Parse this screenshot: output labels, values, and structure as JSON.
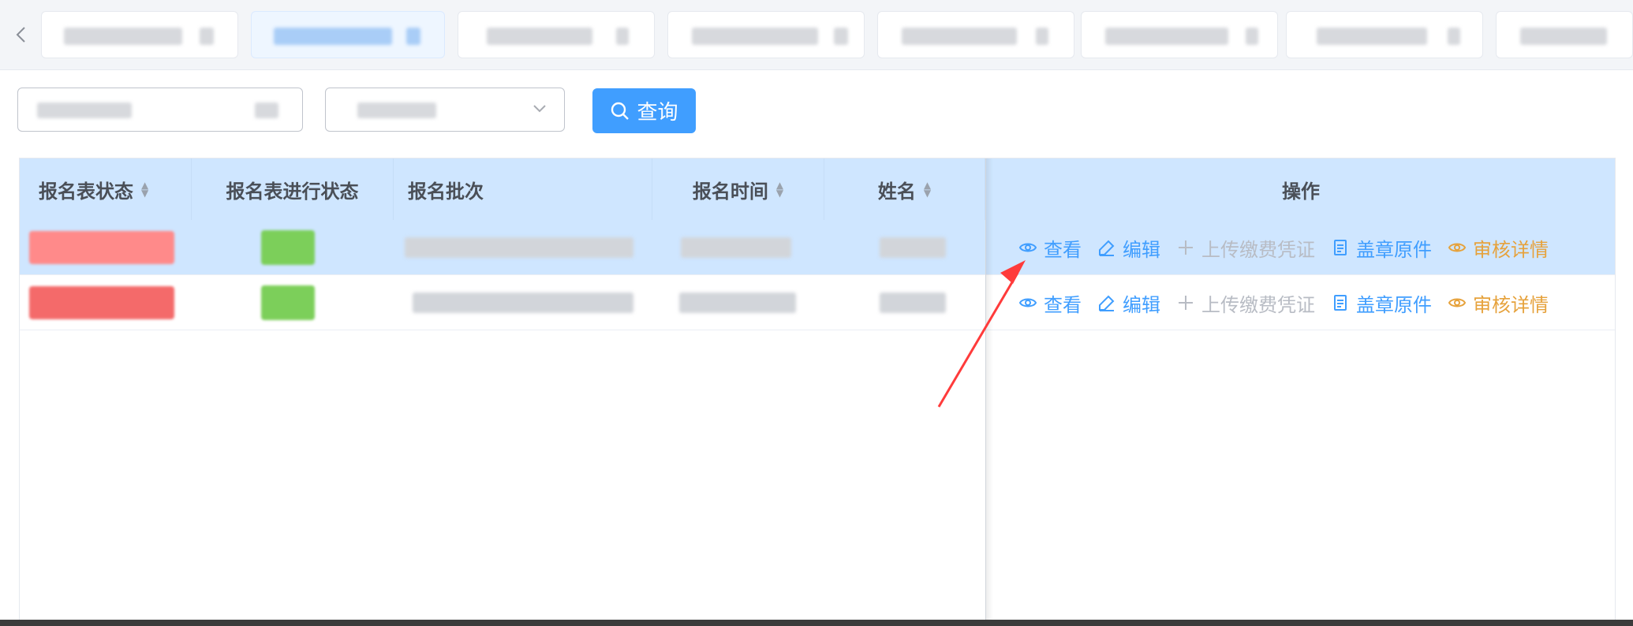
{
  "query_button": {
    "label": "查询"
  },
  "table": {
    "headers": {
      "status": "报名表状态",
      "progress": "报名表进行状态",
      "batch": "报名批次",
      "time": "报名时间",
      "name": "姓名",
      "actions": "操作"
    },
    "action_labels": {
      "view": "查看",
      "edit": "编辑",
      "upload": "上传缴费凭证",
      "stamp": "盖章原件",
      "audit": "审核详情"
    }
  },
  "colors": {
    "primary": "#409eff",
    "header_bg": "#cfe6ff",
    "disabled": "#b8bcc4",
    "warning": "#e6a23c",
    "annotation": "#ff3b3b"
  }
}
